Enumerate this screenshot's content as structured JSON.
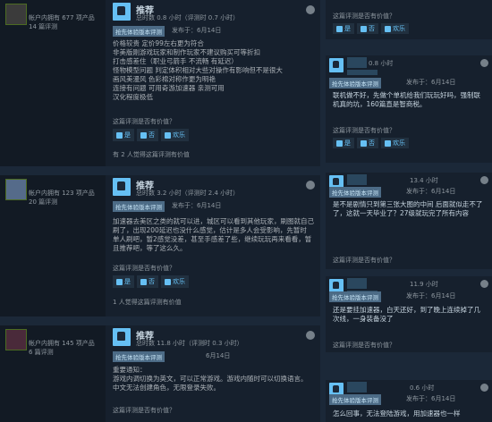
{
  "reviews": [
    {
      "owner_line": "帐户内拥有 677 项产品",
      "reviews_line": "14 篇评测",
      "title": "推荐",
      "hours": "总时数 0.8 小时（评测时 0.7 小时）",
      "badge": "抢先体验版本评测",
      "posted": "发布于：6月14日",
      "body": [
        "价格较贵 定价99左右更为符合",
        "非美版刚游戏玩家和制作玩家不建议购买可等折扣",
        "打击感差住（职业弓箭手 不流畅 有延迟）",
        "怪物模型问题 判定体积相对大些对操作有影响但不是很大",
        "画风美漫风 色彩棉对称作更为明艳",
        "连接有问题 可用奇游加速器 亲测可用",
        "汉化程度极低"
      ],
      "helpful_q": "这篇评测是否有价值？",
      "yes": "是",
      "no": "否",
      "funny": "欢乐",
      "votes": "有 2 人觉得这篇评测有价值"
    },
    {
      "owner_line": "帐户内拥有 123 项产品",
      "reviews_line": "20 篇评测",
      "title": "推荐",
      "hours": "总时数 3.2 小时（评测时 2.4 小时）",
      "badge": "抢先体验版本评测",
      "posted": "发布于：6月14日",
      "body": [
        "加速器去美区之类的就可以进，城区可以看到其他玩家，刷图就自己",
        "刷了，出现200延迟也没什么感觉，估计是多人会受影响，先暂时",
        "单人刷吧，暂2感觉没差，甚至手感差了些，继续玩玩再来看看，暂",
        "且推荐吧，等了这么久。"
      ],
      "helpful_q": "这篇评测是否有价值？",
      "yes": "是",
      "no": "否",
      "funny": "欢乐",
      "votes": "1 人觉得这篇评测有价值"
    },
    {
      "owner_line": "帐户内拥有 145 项产品",
      "reviews_line": "6 篇评测",
      "title": "推荐",
      "hours": "总时数 11.8 小时（评测时 0.3 小时）",
      "badge": "抢先体验版本评测",
      "posted": "6月14日",
      "body": [
        "重要通知：",
        "游戏内调切换为英文，可以正常游戏。游戏内随时可以切换语言。",
        "中文无法创建角色，无限登录失败。"
      ],
      "helpful_q": "这篇评测是否有价值？"
    }
  ],
  "side": [
    {
      "q": "这篇评测是否有价值？",
      "yes": "是",
      "no": "否",
      "funny": "欢乐"
    },
    {
      "hours": "0.8 小时",
      "badge": "抢先体验版本评测",
      "posted": "发布于：6月14日",
      "body": [
        "联机做不好，先做个单机给我们玩玩好吗，强制联",
        "机真的坑，160篇直是智商税。"
      ],
      "q": "这篇评测是否有价值？",
      "yes": "是",
      "no": "否",
      "funny": "欢乐"
    },
    {
      "hours": "13.4 小时",
      "badge": "抢先体验版本评测",
      "posted": "发布于：6月14日",
      "body": [
        "是不是剧情只到第三张大图的中间 后面就似走不了",
        "了，这就一天毕业了？27级就玩完了所有内容"
      ],
      "q": "这篇评测是否有价值？"
    },
    {
      "hours": "11.9 小时",
      "badge": "抢先体验版本评测",
      "posted": "发布于：6月14日",
      "body": [
        "还是要挂加速器，白天还好，到了晚上连续掉了几",
        "次线，一身装备没了"
      ],
      "q": "这篇评测是否有价值？"
    },
    {
      "hours": "0.6 小时",
      "badge": "抢先体验版本评测",
      "posted": "发布于：6月14日",
      "body": [
        "怎么回事，无法登陆游戏，用加速器也一样"
      ]
    }
  ]
}
